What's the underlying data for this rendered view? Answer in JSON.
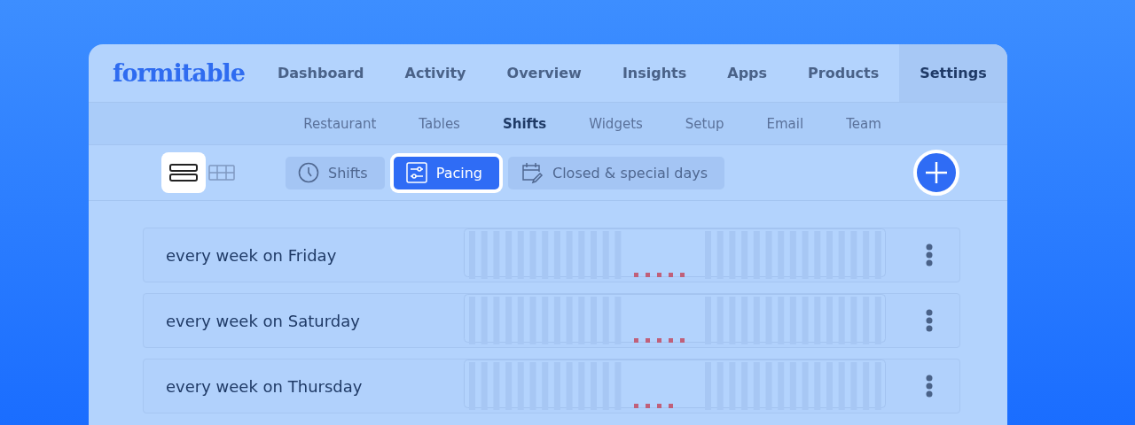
{
  "logo": "formitable",
  "nav": [
    {
      "label": "Dashboard",
      "selected": false
    },
    {
      "label": "Activity",
      "selected": false
    },
    {
      "label": "Overview",
      "selected": false
    },
    {
      "label": "Insights",
      "selected": false
    },
    {
      "label": "Apps",
      "selected": false
    },
    {
      "label": "Products",
      "selected": false
    },
    {
      "label": "Settings",
      "selected": true
    }
  ],
  "subnav": [
    {
      "label": "Restaurant",
      "selected": false
    },
    {
      "label": "Tables",
      "selected": false
    },
    {
      "label": "Shifts",
      "selected": true
    },
    {
      "label": "Widgets",
      "selected": false
    },
    {
      "label": "Setup",
      "selected": false
    },
    {
      "label": "Email",
      "selected": false
    },
    {
      "label": "Team",
      "selected": false
    }
  ],
  "view_toggle": [
    {
      "kind": "list",
      "selected": true
    },
    {
      "kind": "grid",
      "selected": false
    }
  ],
  "tabs": [
    {
      "label": "Shifts",
      "kind": "clock",
      "selected": false
    },
    {
      "label": "Pacing",
      "kind": "sliders",
      "selected": true
    },
    {
      "label": "Closed & special days",
      "kind": "calendar",
      "selected": false
    }
  ],
  "rows": [
    {
      "label": "every week on Friday"
    },
    {
      "label": "every week on Saturday"
    },
    {
      "label": "every week on Thursday"
    }
  ]
}
